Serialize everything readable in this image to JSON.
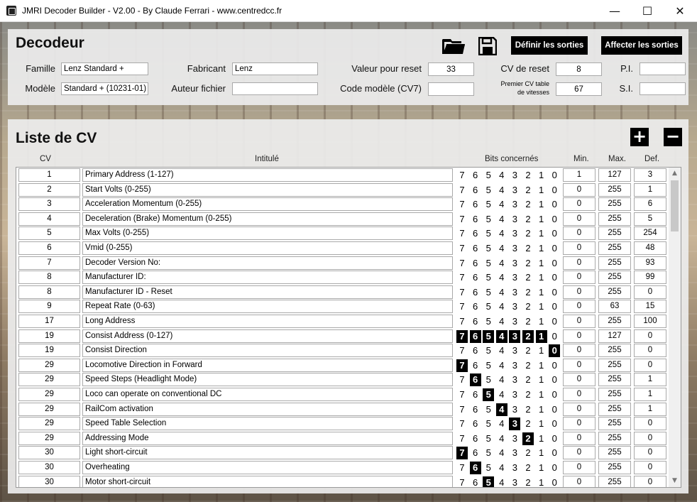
{
  "window": {
    "title": "JMRI Decoder Builder - V2.00 - By Claude Ferrari - www.centredcc.fr",
    "minimize": "—",
    "maximize": "☐",
    "close": "✕"
  },
  "decoder": {
    "heading": "Decodeur",
    "open_icon": "folder-open-icon",
    "save_icon": "floppy-disk-icon",
    "define_outputs": "Définir les sorties",
    "assign_outputs": "Affecter les sorties",
    "famille_label": "Famille",
    "famille_value": "Lenz Standard +",
    "modele_label": "Modèle",
    "modele_value": "Standard + (10231-01)",
    "fabricant_label": "Fabricant",
    "fabricant_value": "Lenz",
    "auteur_label": "Auteur fichier",
    "auteur_value": "",
    "reset_value_label": "Valeur pour reset",
    "reset_value": "33",
    "code_label": "Code modèle (CV7)",
    "code_value": "",
    "cv_reset_label": "CV de reset",
    "cv_reset_value": "8",
    "speed_table_label_1": "Premier CV table",
    "speed_table_label_2": "de vitesses",
    "speed_table_value": "67",
    "pi_label": "P.I.",
    "pi_value": "",
    "si_label": "S.I.",
    "si_value": ""
  },
  "cv_list": {
    "heading": "Liste de CV",
    "add_icon": "plus-icon",
    "remove_icon": "minus-icon",
    "columns": {
      "cv": "CV",
      "label": "Intitulé",
      "bits": "Bits concernés",
      "min": "Min.",
      "max": "Max.",
      "def": "Def."
    },
    "rows": [
      {
        "cv": "1",
        "label": "Primary Address (1-127)",
        "bits": [],
        "min": "1",
        "max": "127",
        "def": "3"
      },
      {
        "cv": "2",
        "label": "Start Volts (0-255)",
        "bits": [],
        "min": "0",
        "max": "255",
        "def": "1"
      },
      {
        "cv": "3",
        "label": "Acceleration Momentum (0-255)",
        "bits": [],
        "min": "0",
        "max": "255",
        "def": "6"
      },
      {
        "cv": "4",
        "label": "Deceleration (Brake) Momentum (0-255)",
        "bits": [],
        "min": "0",
        "max": "255",
        "def": "5"
      },
      {
        "cv": "5",
        "label": "Max Volts (0-255)",
        "bits": [],
        "min": "0",
        "max": "255",
        "def": "254"
      },
      {
        "cv": "6",
        "label": "Vmid (0-255)",
        "bits": [],
        "min": "0",
        "max": "255",
        "def": "48"
      },
      {
        "cv": "7",
        "label": "Decoder Version No:",
        "bits": [],
        "min": "0",
        "max": "255",
        "def": "93"
      },
      {
        "cv": "8",
        "label": "Manufacturer ID:",
        "bits": [],
        "min": "0",
        "max": "255",
        "def": "99"
      },
      {
        "cv": "8",
        "label": "Manufacturer ID - Reset",
        "bits": [],
        "min": "0",
        "max": "255",
        "def": "0"
      },
      {
        "cv": "9",
        "label": "Repeat Rate (0-63)",
        "bits": [],
        "min": "0",
        "max": "63",
        "def": "15"
      },
      {
        "cv": "17",
        "label": "Long Address",
        "bits": [],
        "min": "0",
        "max": "255",
        "def": "100"
      },
      {
        "cv": "19",
        "label": "Consist Address (0-127)",
        "bits": [
          7,
          6,
          5,
          4,
          3,
          2,
          1
        ],
        "min": "0",
        "max": "127",
        "def": "0"
      },
      {
        "cv": "19",
        "label": "Consist Direction",
        "bits": [
          0
        ],
        "min": "0",
        "max": "255",
        "def": "0"
      },
      {
        "cv": "29",
        "label": "Locomotive Direction in Forward",
        "bits": [
          7
        ],
        "min": "0",
        "max": "255",
        "def": "0"
      },
      {
        "cv": "29",
        "label": "Speed Steps (Headlight Mode)",
        "bits": [
          6
        ],
        "min": "0",
        "max": "255",
        "def": "1"
      },
      {
        "cv": "29",
        "label": "Loco can operate on conventional DC",
        "bits": [
          5
        ],
        "min": "0",
        "max": "255",
        "def": "1"
      },
      {
        "cv": "29",
        "label": "RailCom activation",
        "bits": [
          4
        ],
        "min": "0",
        "max": "255",
        "def": "1"
      },
      {
        "cv": "29",
        "label": "Speed Table Selection",
        "bits": [
          3
        ],
        "min": "0",
        "max": "255",
        "def": "0"
      },
      {
        "cv": "29",
        "label": "Addressing Mode",
        "bits": [
          2
        ],
        "min": "0",
        "max": "255",
        "def": "0"
      },
      {
        "cv": "30",
        "label": "Light short-circuit",
        "bits": [
          7
        ],
        "min": "0",
        "max": "255",
        "def": "0"
      },
      {
        "cv": "30",
        "label": "Overheating",
        "bits": [
          6
        ],
        "min": "0",
        "max": "255",
        "def": "0"
      },
      {
        "cv": "30",
        "label": "Motor short-circuit",
        "bits": [
          5
        ],
        "min": "0",
        "max": "255",
        "def": "0"
      }
    ]
  }
}
